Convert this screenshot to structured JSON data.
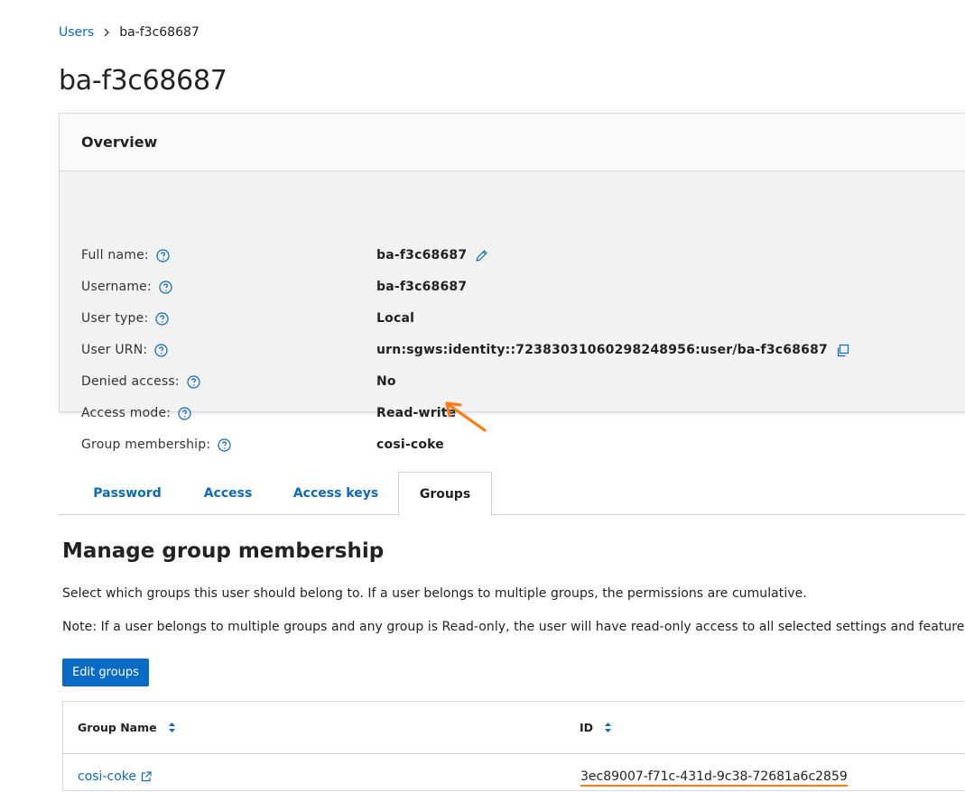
{
  "breadcrumb": {
    "parent": "Users",
    "current": "ba-f3c68687"
  },
  "page_title": "ba-f3c68687",
  "overview": {
    "title": "Overview",
    "rows": [
      {
        "label": "Full name:",
        "value": "ba-f3c68687",
        "action_icon": "pencil-icon"
      },
      {
        "label": "Username:",
        "value": "ba-f3c68687"
      },
      {
        "label": "User type:",
        "value": "Local"
      },
      {
        "label": "User URN:",
        "value": "urn:sgws:identity::72383031060298248956:user/ba-f3c68687",
        "action_icon": "copy-icon"
      },
      {
        "label": "Denied access:",
        "value": "No"
      },
      {
        "label": "Access mode:",
        "value": "Read-write"
      },
      {
        "label": "Group membership:",
        "value": "cosi-coke"
      }
    ]
  },
  "tabs": [
    {
      "label": "Password",
      "active": false
    },
    {
      "label": "Access",
      "active": false
    },
    {
      "label": "Access keys",
      "active": false
    },
    {
      "label": "Groups",
      "active": true
    }
  ],
  "groups_section": {
    "title": "Manage group membership",
    "description": "Select which groups this user should belong to. If a user belongs to multiple groups, the permissions are cumulative.",
    "note": "Note: If a user belongs to multiple groups and any group is Read-only, the user will have read-only access to all selected settings and features.",
    "edit_button": "Edit groups",
    "table": {
      "columns": [
        "Group Name",
        "ID"
      ],
      "rows": [
        {
          "name": "cosi-coke",
          "id": "3ec89007-f71c-431d-9c38-72681a6c2859"
        }
      ]
    }
  },
  "colors": {
    "link": "#0d6ab8",
    "primary_button": "#0a6bc5",
    "annotation": "#ff7a12",
    "overview_bg": "#f2f2f2"
  }
}
